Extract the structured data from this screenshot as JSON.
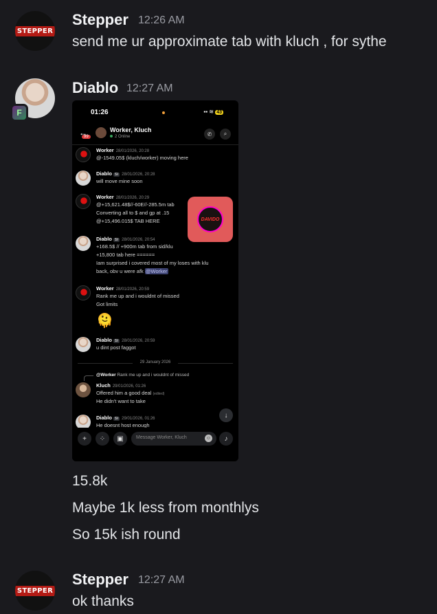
{
  "messages": [
    {
      "author": "Stepper",
      "time": "12:26 AM",
      "avatar_text": "STEPPER",
      "lines": [
        "send me ur approximate tab with kluch , for sythe"
      ]
    },
    {
      "author": "Diablo",
      "time": "12:27 AM",
      "lines": [
        "15.8k",
        "Maybe 1k less from monthlys",
        "So 15k ish round"
      ]
    },
    {
      "author": "Stepper",
      "time": "12:27 AM",
      "avatar_text": "STEPPER",
      "lines": [
        "ok thanks"
      ]
    }
  ],
  "attachment": {
    "status": {
      "time": "01:26",
      "battery": "43"
    },
    "header": {
      "back_badge": "99",
      "title": "Worker, Kluch",
      "subtitle": "2 Online"
    },
    "chat": [
      {
        "author": "Worker",
        "ts": "28/01/2026, 20:28",
        "lines": [
          "@-1549.05$ (kluch/worker) moving here"
        ]
      },
      {
        "author": "Diablo",
        "tag": "SI",
        "ts": "28/01/2026, 20:28",
        "lines": [
          "will move mine soon"
        ]
      },
      {
        "author": "Worker",
        "ts": "28/01/2026, 20:29",
        "lines": [
          "@+15,621.48$//-60E//-285.5m tab",
          "Converting all to $ and gp at .15",
          "@+15,496.015$ TAB HERE"
        ]
      },
      {
        "author": "Diablo",
        "tag": "SI",
        "ts": "28/01/2026, 20:54",
        "lines": [
          "+168.5$ // +900m tab  from sid/klu",
          "+15,800 tab here ======",
          "Iam surprised i covered most of my loses with klu",
          "back, obv u were afk"
        ],
        "mention": "@Worker"
      },
      {
        "author": "Worker",
        "ts": "28/01/2026, 20:59",
        "lines": [
          "Rank me up and i wouldnt of missed",
          "Got limits"
        ],
        "emoji": "🫠"
      },
      {
        "author": "Diablo",
        "tag": "SI",
        "ts": "28/01/2026, 20:59",
        "lines": [
          "u dint post faggot"
        ]
      },
      {
        "author": "Kluch",
        "ts": "29/01/2026, 01:26",
        "lines": [
          "Offered him a good deal",
          "He didn't want to take"
        ],
        "edited": "(edited)"
      },
      {
        "author": "Diablo",
        "tag": "SI",
        "ts": "29/01/2026, 01:26",
        "lines": [
          "He doesnt host enough"
        ]
      }
    ],
    "sticker_text": "DAVIDO",
    "date_divider": "29 January 2026",
    "reply": {
      "author": "@Worker",
      "text": "Rank me up and i wouldnt of missed"
    },
    "input_placeholder": "Message Worker, Kluch"
  }
}
